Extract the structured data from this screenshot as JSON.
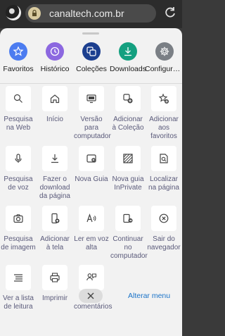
{
  "address_bar": {
    "url": "canaltech.com.br"
  },
  "top_row": [
    {
      "label": "Favoritos",
      "color": "#4c7cf0"
    },
    {
      "label": "Histórico",
      "color": "#8c68e0"
    },
    {
      "label": "Coleções",
      "color": "#1c3f8f"
    },
    {
      "label": "Downloads",
      "color": "#14a080"
    },
    {
      "label": "Configurações",
      "color": "#7a7f85"
    }
  ],
  "grid_items": [
    {
      "label": "Pesquisa na Web",
      "icon": "search-icon"
    },
    {
      "label": "Início",
      "icon": "home-icon"
    },
    {
      "label": "Versão para computador",
      "icon": "desktop-icon"
    },
    {
      "label": "Adicionar à Coleção",
      "icon": "add-collection-icon"
    },
    {
      "label": "Adicionar aos favoritos",
      "icon": "add-favorite-icon"
    },
    {
      "label": "Pesquisa de voz",
      "icon": "microphone-icon"
    },
    {
      "label": "Fazer o download da página",
      "icon": "download-page-icon"
    },
    {
      "label": "Nova Guia",
      "icon": "new-tab-icon"
    },
    {
      "label": "Nova guia InPrivate",
      "icon": "inprivate-icon"
    },
    {
      "label": "Localizar na página",
      "icon": "find-in-page-icon"
    },
    {
      "label": "Pesquisa de imagem",
      "icon": "camera-icon"
    },
    {
      "label": "Adicionar à tela",
      "icon": "add-to-screen-icon"
    },
    {
      "label": "Ler em voz alta",
      "icon": "read-aloud-icon"
    },
    {
      "label": "Continuar no computador",
      "icon": "continue-on-pc-icon"
    },
    {
      "label": "Sair do navegador",
      "icon": "exit-icon"
    },
    {
      "label": "Ver a lista de leitura",
      "icon": "reading-list-icon"
    },
    {
      "label": "Imprimir",
      "icon": "printer-icon"
    },
    {
      "label": "Enviar comentários",
      "icon": "feedback-icon"
    }
  ],
  "bottom": {
    "edit_menu": "Alterar menu"
  }
}
